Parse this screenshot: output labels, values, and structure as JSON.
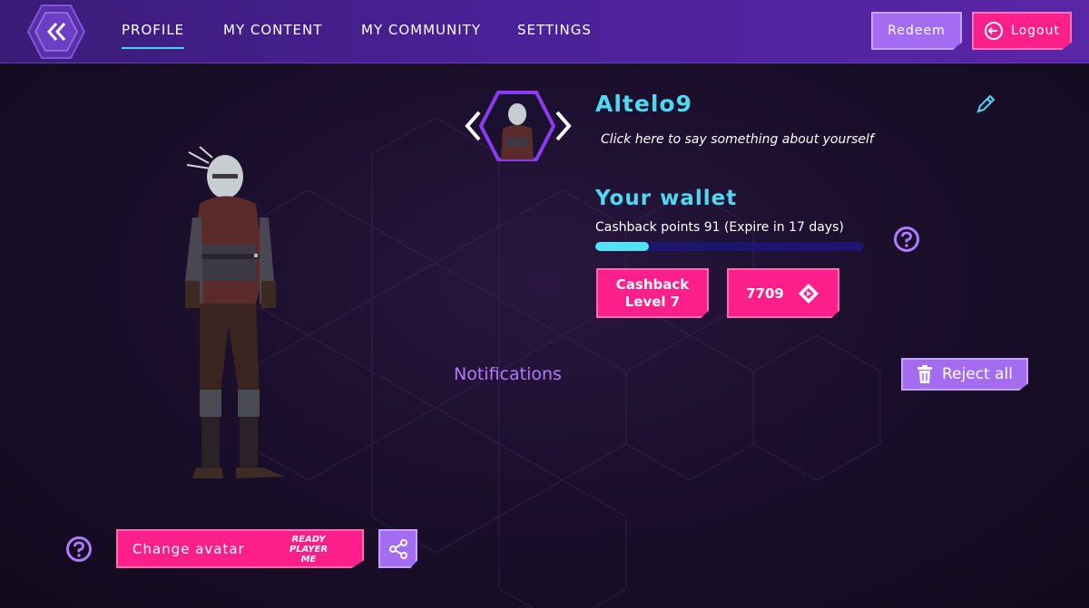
{
  "nav": {
    "back_icon": "double-chevron-left-icon",
    "tabs": [
      {
        "label": "PROFILE",
        "active": true
      },
      {
        "label": "MY CONTENT",
        "active": false
      },
      {
        "label": "MY COMMUNITY",
        "active": false
      },
      {
        "label": "SETTINGS",
        "active": false
      }
    ],
    "redeem_label": "Redeem",
    "logout_label": "Logout",
    "logout_icon": "logout-icon"
  },
  "profile": {
    "username": "Altelo9",
    "bio_placeholder": "Click here to say something about yourself",
    "edit_icon": "pencil-icon"
  },
  "wallet": {
    "title": "Your wallet",
    "cashback_text": "Cashback points 91 (Expire in 17 days)",
    "progress_fraction": 0.2,
    "level_line1": "Cashback",
    "level_line2": "Level 7",
    "coins": "7709",
    "coin_icon": "diamond-coin-icon"
  },
  "notifications": {
    "title": "Notifications",
    "reject_all_label": "Reject all",
    "reject_icon": "trash-icon"
  },
  "avatar": {
    "change_label": "Change avatar",
    "rpm_logo_lines": [
      "READY",
      "PLAYER",
      "ME"
    ],
    "share_icon": "share-icon"
  },
  "colors": {
    "accent_cyan": "#4fd9f0",
    "accent_pink": "#ff1f8a",
    "accent_purple": "#a46cf0",
    "nav_bg": "#4a2196",
    "page_bg": "#140a22"
  }
}
